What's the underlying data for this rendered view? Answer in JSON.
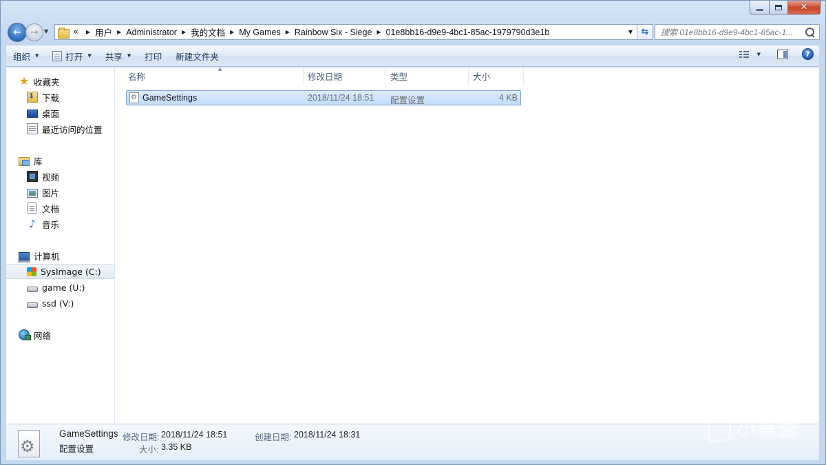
{
  "window": {
    "minimize_symbol": "",
    "maximize_symbol": "",
    "close_symbol": "✕"
  },
  "nav": {
    "overflow": "«",
    "breadcrumbs": [
      "用户",
      "Administrator",
      "我的文档",
      "My Games",
      "Rainbow Six - Siege",
      "01e8bb16-d9e9-4bc1-85ac-1979790d3e1b"
    ],
    "search_placeholder": "搜索 01e8bb16-d9e9-4bc1-85ac-1..."
  },
  "toolbar": {
    "organize_label": "组织",
    "open_label": "打开",
    "share_label": "共享",
    "print_label": "打印",
    "new_folder_label": "新建文件夹"
  },
  "sidebar": {
    "favorites": {
      "label": "收藏夹",
      "items": [
        "下载",
        "桌面",
        "最近访问的位置"
      ]
    },
    "libraries": {
      "label": "库",
      "items": [
        "视频",
        "图片",
        "文档",
        "音乐"
      ]
    },
    "computer": {
      "label": "计算机",
      "items": [
        "SysImage (C:)",
        "game (U:)",
        "ssd (V:)"
      ]
    },
    "network": {
      "label": "网络"
    }
  },
  "columns": [
    "名称",
    "修改日期",
    "类型",
    "大小"
  ],
  "files": [
    {
      "name": "GameSettings",
      "modified": "2018/11/24 18:51",
      "type": "配置设置",
      "size": "4 KB"
    }
  ],
  "details": {
    "name": "GameSettings",
    "type": "配置设置",
    "modified_label": "修改日期:",
    "modified_value": "2018/11/24 18:51",
    "created_label": "创建日期:",
    "created_value": "2018/11/24 18:31",
    "size_label": "大小:",
    "size_value": "3.35 KB"
  },
  "watermark": {
    "text": "小黑盒"
  },
  "colors": {
    "selection": "#cce4fc",
    "close_button": "#c8452c",
    "frame": "#c4d8f0"
  }
}
